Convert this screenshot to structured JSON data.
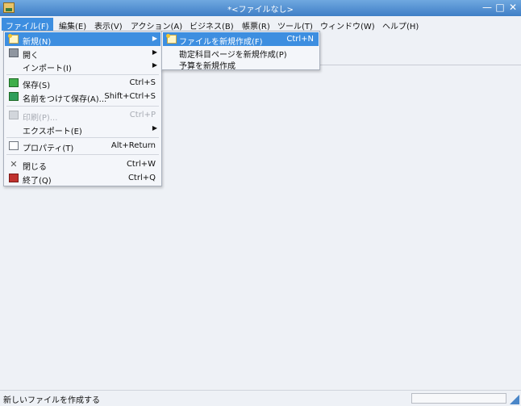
{
  "window": {
    "title": "*<ファイルなし>",
    "minimize_glyph": "—",
    "maximize_glyph": "□",
    "close_glyph": "✕"
  },
  "menubar": {
    "items": [
      "ファイル(F)",
      "編集(E)",
      "表示(V)",
      "アクション(A)",
      "ビジネス(B)",
      "帳票(R)",
      "ツール(T)",
      "ウィンドウ(W)",
      "ヘルプ(H)"
    ]
  },
  "file_menu": {
    "new": {
      "label": "新規(N)",
      "icon": "new-file-icon"
    },
    "open": {
      "label": "開く",
      "icon": "folder-open-icon"
    },
    "import": {
      "label": "インポート(I)"
    },
    "save": {
      "label": "保存(S)",
      "shortcut": "Ctrl+S",
      "icon": "save-icon"
    },
    "save_as": {
      "label": "名前をつけて保存(A)...",
      "shortcut": "Shift+Ctrl+S",
      "icon": "save-as-icon"
    },
    "print": {
      "label": "印刷(P)...",
      "shortcut": "Ctrl+P",
      "icon": "print-icon",
      "disabled": true
    },
    "export": {
      "label": "エクスポート(E)"
    },
    "properties": {
      "label": "プロパティ(T)",
      "shortcut": "Alt+Return",
      "icon": "properties-icon"
    },
    "close": {
      "label": "閉じる",
      "shortcut": "Ctrl+W",
      "icon": "close-icon"
    },
    "quit": {
      "label": "終了(Q)",
      "shortcut": "Ctrl+Q",
      "icon": "quit-icon"
    },
    "submenu_arrow": "▶"
  },
  "new_submenu": {
    "new_file": {
      "label": "ファイルを新規作成(F)",
      "shortcut": "Ctrl+N",
      "icon": "new-file-icon"
    },
    "new_account_page": {
      "label": "勘定科目ページを新規作成(P)"
    },
    "new_budget": {
      "label": "予算を新規作成"
    }
  },
  "statusbar": {
    "text": "新しいファイルを作成する"
  },
  "colors": {
    "highlight": "#3d8ee0",
    "titlebar": "#4a8ad4",
    "background": "#eef1f6"
  }
}
